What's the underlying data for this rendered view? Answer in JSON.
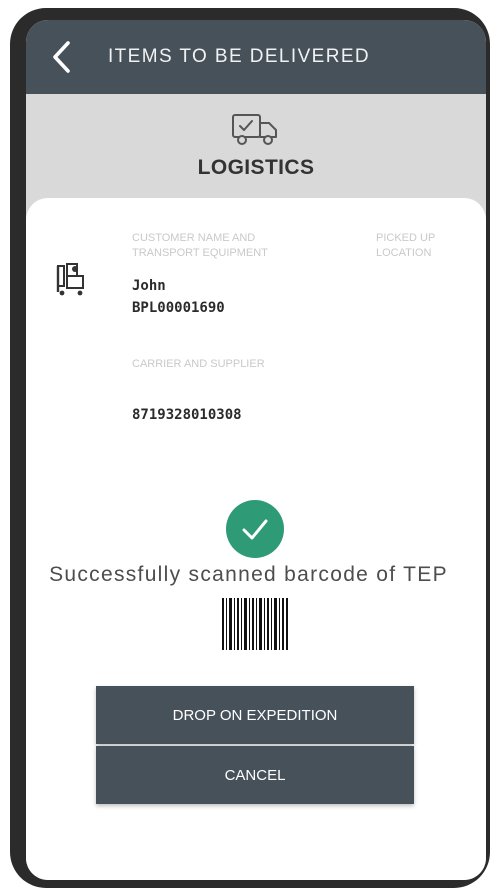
{
  "header": {
    "title": "ITEMS TO BE DELIVERED",
    "back_icon": "chevron-left-icon"
  },
  "section": {
    "title": "LOGISTICS",
    "icon": "delivery-truck-icon"
  },
  "details": {
    "icon": "trolley-icon",
    "customer_label_line1": "CUSTOMER NAME AND",
    "customer_label_line2": "TRANSPORT EQUIPMENT",
    "picked_label_line1": "PICKED UP",
    "picked_label_line2": "LOCATION",
    "customer_name": "John",
    "equipment_id": "BPL00001690",
    "carrier_label": "CARRIER AND SUPPLIER",
    "carrier_value": "8719328010308"
  },
  "status": {
    "icon": "check-circle-icon",
    "message": "Successfully scanned barcode of TEP",
    "barcode_icon": "barcode-icon",
    "accent": "#2f9a76"
  },
  "actions": {
    "primary": "DROP ON EXPEDITION",
    "secondary": "CANCEL"
  },
  "colors": {
    "header_bg": "#47515a",
    "band_bg": "#d9d9d9"
  }
}
